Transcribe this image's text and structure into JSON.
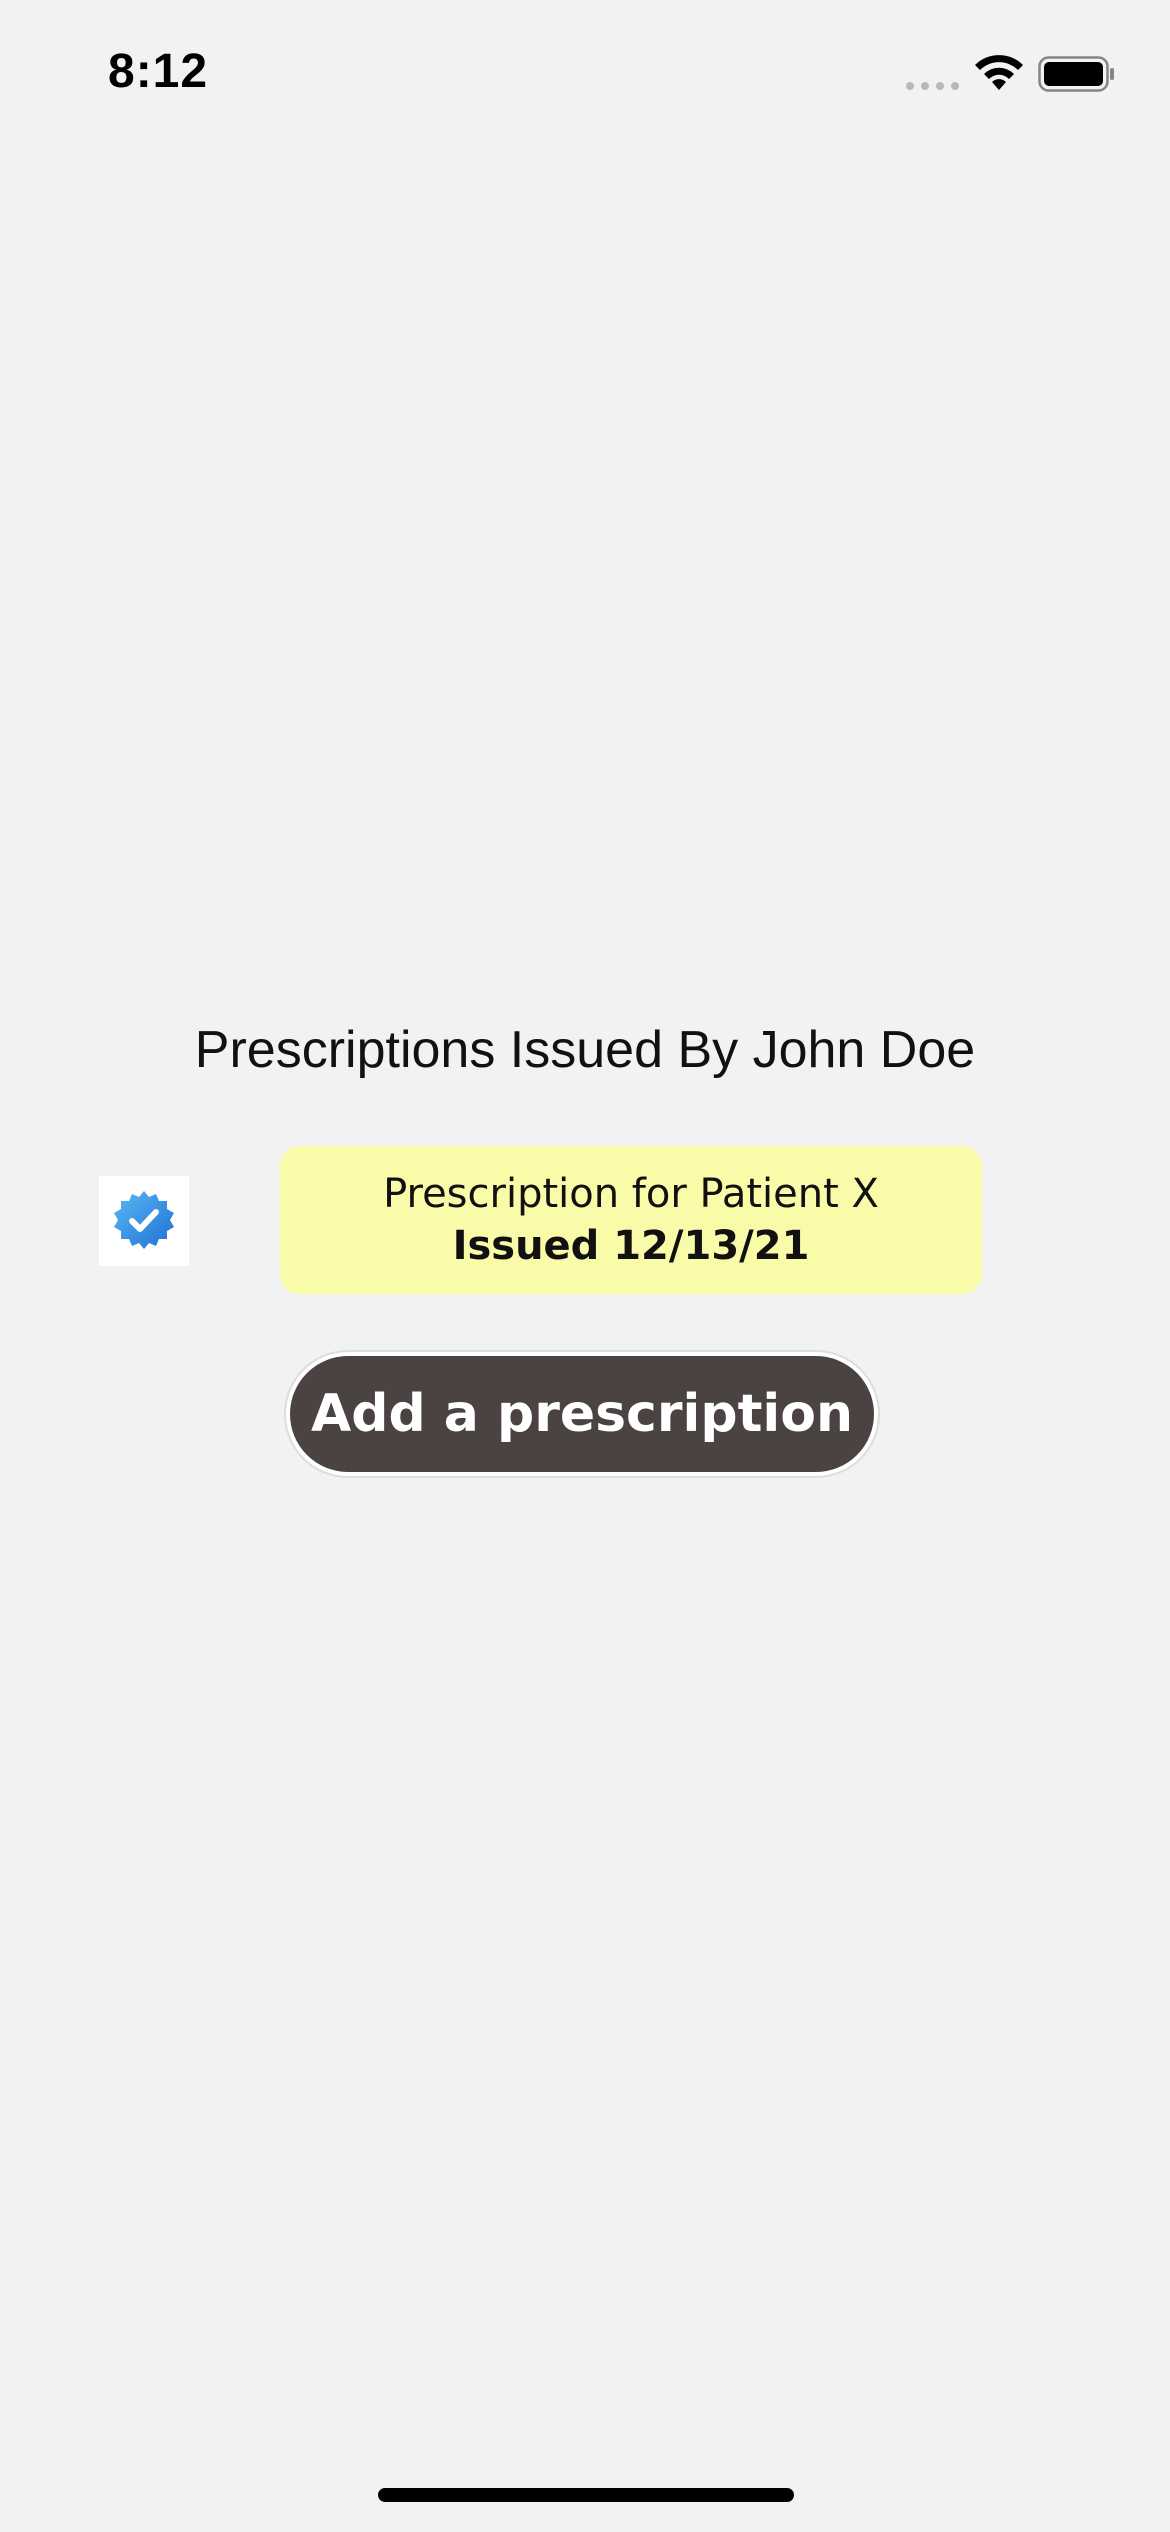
{
  "status_bar": {
    "time": "8:12",
    "icons": [
      "signal-dots-icon",
      "wifi-icon",
      "battery-icon"
    ]
  },
  "page": {
    "title": "Prescriptions Issued By John Doe"
  },
  "prescriptions": [
    {
      "name": "Prescription for Patient X",
      "issued": "Issued 12/13/21",
      "badge_icon": "verified-badge-icon",
      "card_color": "#fafba8",
      "badge_color": "#2e8fe6"
    }
  ],
  "actions": {
    "add_label": "Add a prescription",
    "button_color": "#4b4342"
  }
}
